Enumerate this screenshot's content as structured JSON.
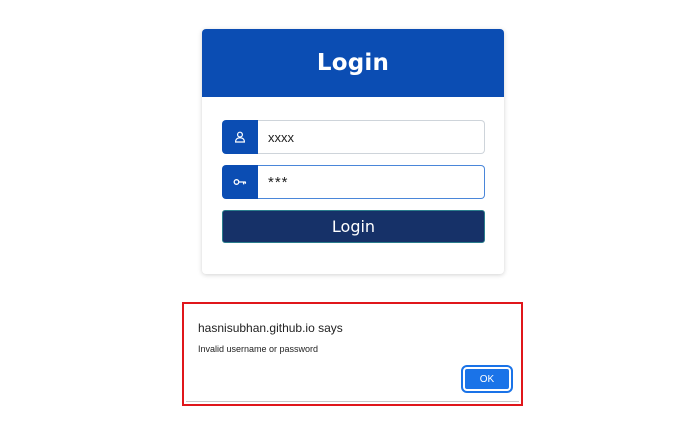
{
  "login_card": {
    "title": "Login",
    "username": {
      "value": "xxxx",
      "icon": "user-icon"
    },
    "password": {
      "value": "***",
      "icon": "key-icon"
    },
    "button_label": "Login"
  },
  "alert": {
    "origin": "hasnisubhan.github.io says",
    "message": "Invalid username or password",
    "ok_label": "OK"
  },
  "colors": {
    "header_blue": "#0b4db3",
    "button_navy": "#163168",
    "ok_blue": "#1a73e8",
    "highlight_red": "#e0161b"
  }
}
